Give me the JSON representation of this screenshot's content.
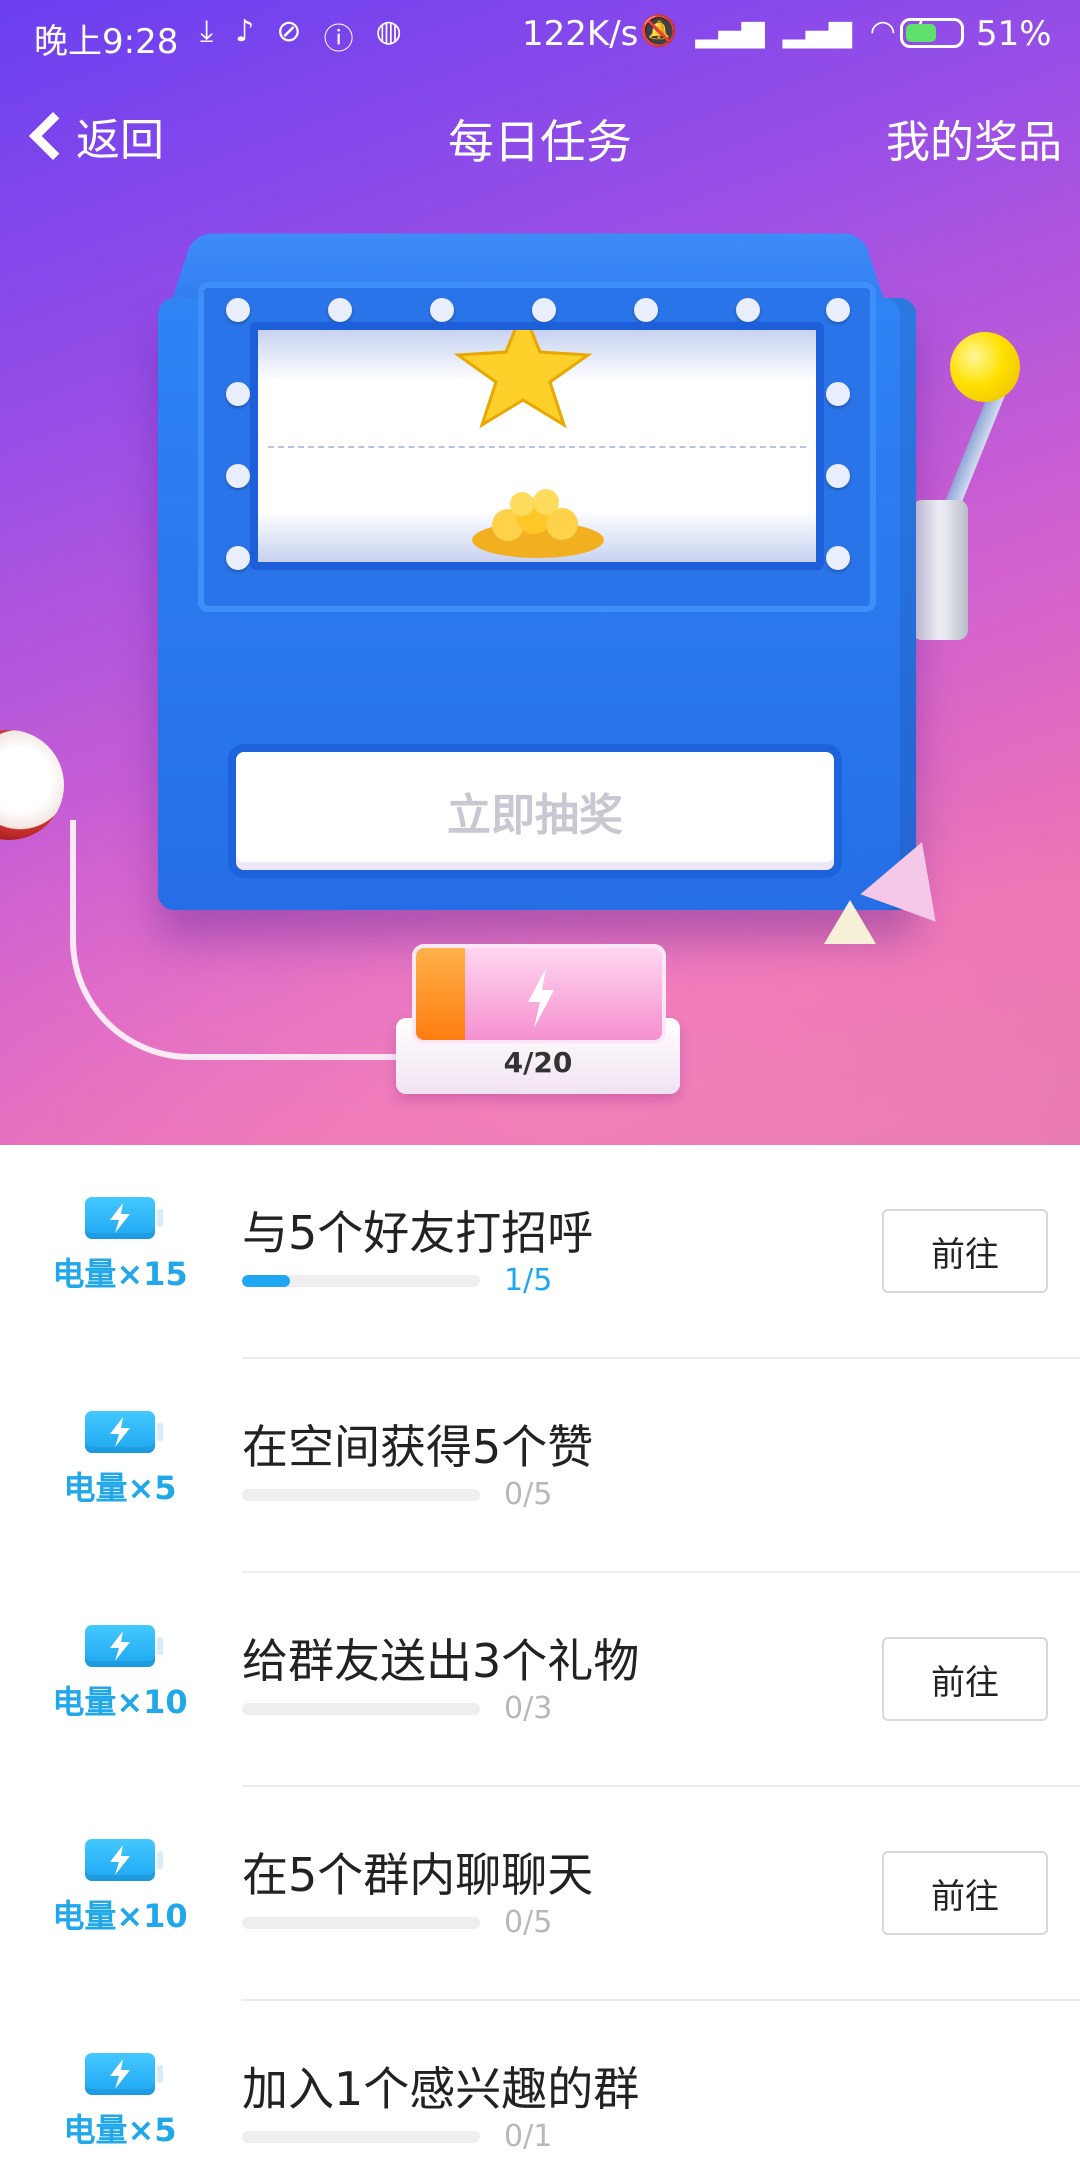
{
  "status_bar": {
    "time": "晚上9:28",
    "speed": "122K/s",
    "battery_pct": "51%",
    "icons_left": [
      "download-icon",
      "music-icon",
      "wifi-off-icon",
      "alert-icon",
      "app-icon"
    ],
    "icons_right": [
      "mute-icon",
      "signal-icon",
      "signal-icon",
      "wifi-icon",
      "charging-icon",
      "battery-icon"
    ]
  },
  "nav": {
    "back_label": "返回",
    "title": "每日任务",
    "right_label": "我的奖品"
  },
  "machine": {
    "button_label": "立即抽奖",
    "energy": "4/20",
    "energy_fraction": 0.2
  },
  "colors": {
    "accent": "#1ea7f2",
    "hero_start": "#6a3ff0",
    "hero_end": "#ec74b5"
  },
  "tasks": [
    {
      "reward": "电量×15",
      "title": "与5个好友打招呼",
      "progress": "1/5",
      "fraction": 0.2,
      "button": "前往",
      "has_button": true
    },
    {
      "reward": "电量×5",
      "title": "在空间获得5个赞",
      "progress": "0/5",
      "fraction": 0,
      "button": "",
      "has_button": false
    },
    {
      "reward": "电量×10",
      "title": "给群友送出3个礼物",
      "progress": "0/3",
      "fraction": 0,
      "button": "前往",
      "has_button": true
    },
    {
      "reward": "电量×10",
      "title": "在5个群内聊聊天",
      "progress": "0/5",
      "fraction": 0,
      "button": "前往",
      "has_button": true
    },
    {
      "reward": "电量×5",
      "title": "加入1个感兴趣的群",
      "progress": "0/1",
      "fraction": 0,
      "button": "",
      "has_button": false
    }
  ]
}
